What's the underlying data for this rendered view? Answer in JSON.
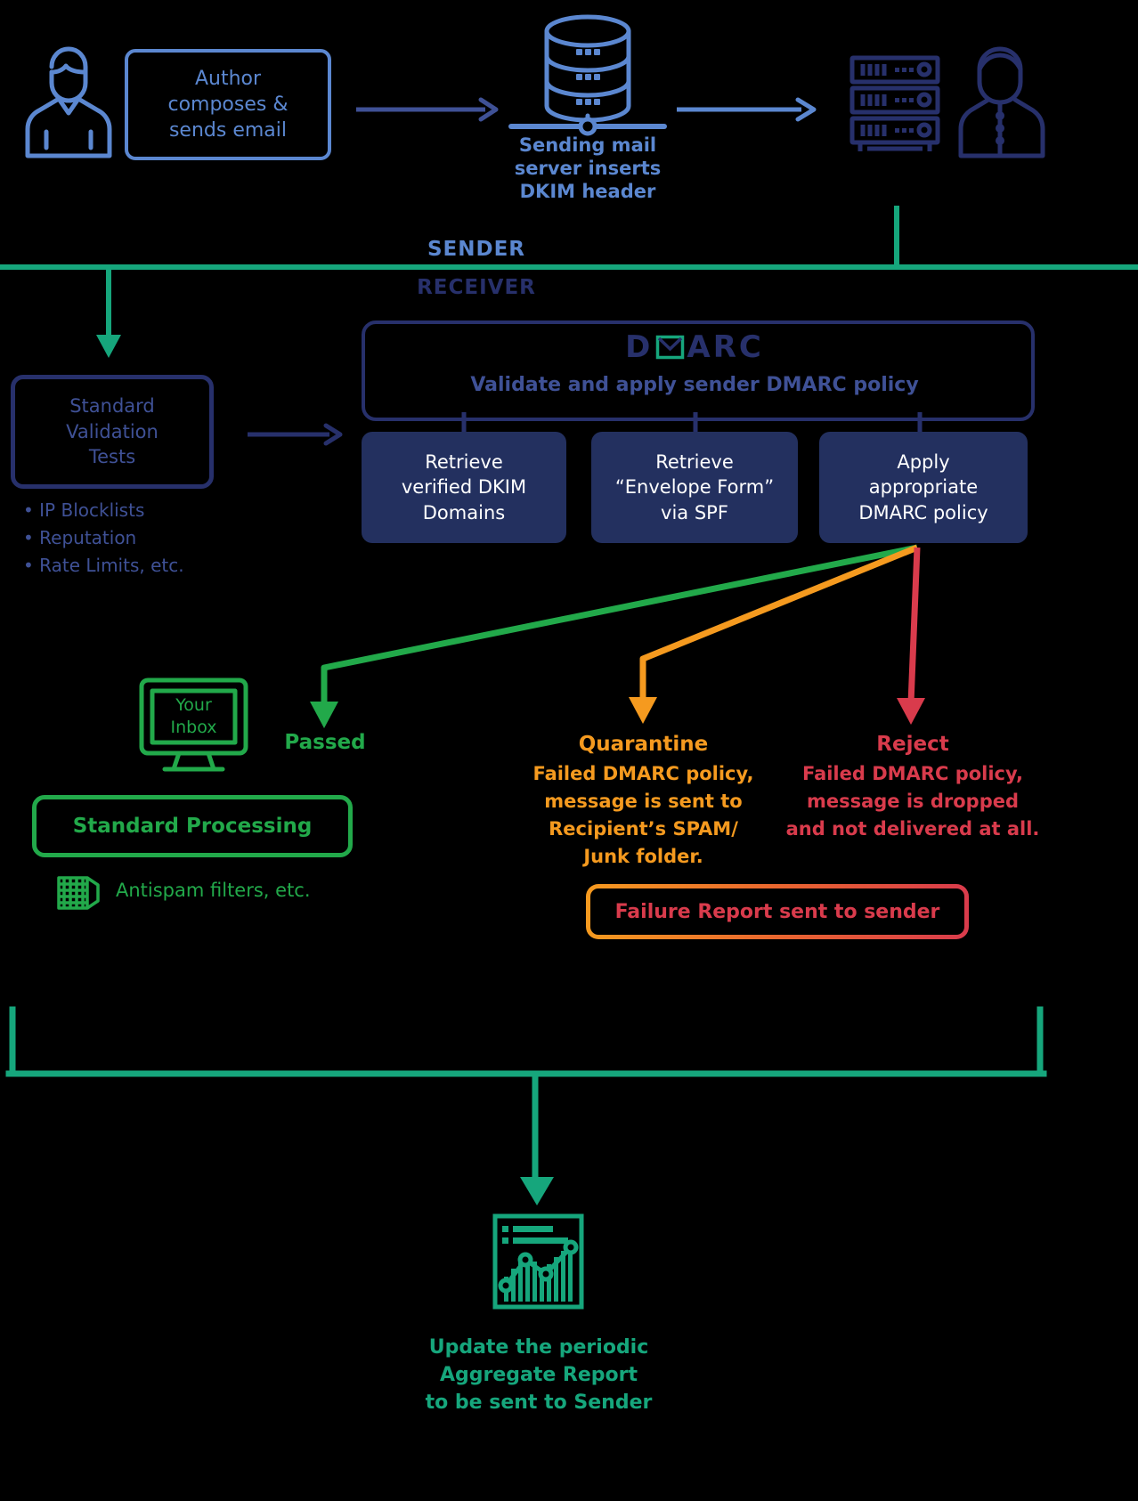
{
  "diagram": {
    "title": "DMARC email authentication flow",
    "colors": {
      "light_blue": "#5b87d0",
      "navy": "#27306b",
      "dark_navy_fill": "#23305f",
      "green": "#22a94a",
      "teal": "#16a67c",
      "orange": "#f59a1f",
      "red": "#d93b4c"
    }
  },
  "sender_row": {
    "author_icon": "person-icon",
    "author_box": "Author\ncomposes &\nsends email",
    "author_box_lines": [
      "Author",
      "composes &",
      "sends email"
    ],
    "arrow1": "arrow-right-icon",
    "server_icon": "database-server-icon",
    "server_caption_lines": [
      "Sending mail",
      "server inserts",
      "DKIM header"
    ],
    "arrow2": "arrow-right-icon",
    "rack_icon": "server-rack-icon",
    "recipient_icon": "person-icon"
  },
  "divider": {
    "sender_label": "SENDER",
    "receiver_label": "RECEIVER"
  },
  "validation": {
    "box_lines": [
      "Standard",
      "Validation",
      "Tests"
    ],
    "bullets": [
      "• IP Blocklists",
      "• Reputation",
      "• Rate Limits, etc."
    ],
    "arrow": "arrow-right-icon"
  },
  "dmarc": {
    "logo_text_pre": "D",
    "logo_icon": "envelope-icon",
    "logo_text_post": "ARC",
    "subtitle": "Validate and apply sender DMARC policy",
    "children": [
      {
        "lines": [
          "Retrieve",
          "verified DKIM",
          "Domains"
        ]
      },
      {
        "lines": [
          "Retrieve",
          "“Envelope Form”",
          "via SPF"
        ]
      },
      {
        "lines": [
          "Apply",
          "appropriate",
          "DMARC policy"
        ]
      }
    ]
  },
  "outcomes": {
    "passed": {
      "label": "Passed",
      "inbox_icon": "monitor-icon",
      "inbox_lines": [
        "Your",
        "Inbox"
      ],
      "processing_label": "Standard Processing",
      "antispam_icon": "filter-icon",
      "antispam_label": "Antispam filters, etc."
    },
    "quarantine": {
      "label": "Quarantine",
      "description_lines": [
        "Failed DMARC policy,",
        "message is sent to",
        "Recipient’s SPAM/",
        "Junk folder."
      ]
    },
    "reject": {
      "label": "Reject",
      "description_lines": [
        "Failed DMARC policy,",
        "message is dropped",
        "and not delivered at all."
      ]
    },
    "failure_report": "Failure Report sent to sender"
  },
  "aggregate": {
    "chart_icon": "report-chart-icon",
    "caption_lines": [
      "Update the periodic",
      "Aggregate Report",
      "to be sent to Sender"
    ]
  }
}
